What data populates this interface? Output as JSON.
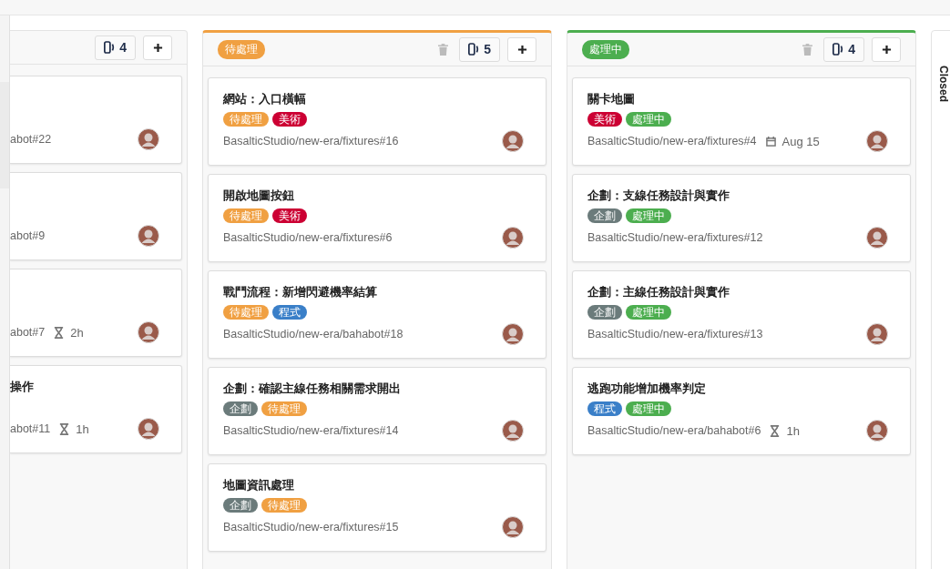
{
  "columns": [
    {
      "deletable": false,
      "count": "4",
      "cut": true,
      "cards": [
        {
          "ref": "abot#22"
        },
        {
          "ref": "abot#9"
        },
        {
          "ref": "abot#7",
          "meta": {
            "kind": "estimate",
            "text": "2h"
          }
        },
        {
          "title": "操作",
          "ref": "abot#11",
          "meta": {
            "kind": "estimate",
            "text": "1h"
          }
        }
      ]
    },
    {
      "label": {
        "text": "待處理",
        "color": "#f0a042"
      },
      "deletable": true,
      "count": "5",
      "cut": false,
      "cards": [
        {
          "title": "網站：入口橫幅",
          "labels": [
            {
              "text": "待處理",
              "color": "#f0a042"
            },
            {
              "text": "美術",
              "color": "#cc0033"
            }
          ],
          "ref": "BasalticStudio/new-era/fixtures#16"
        },
        {
          "title": "開啟地圖按鈕",
          "labels": [
            {
              "text": "待處理",
              "color": "#f0a042"
            },
            {
              "text": "美術",
              "color": "#cc0033"
            }
          ],
          "ref": "BasalticStudio/new-era/fixtures#6"
        },
        {
          "title": "戰鬥流程：新增閃避機率結算",
          "labels": [
            {
              "text": "待處理",
              "color": "#f0a042"
            },
            {
              "text": "程式",
              "color": "#3a7fc8"
            }
          ],
          "ref": "BasalticStudio/new-era/bahabot#18"
        },
        {
          "title": "企劃：確認主線任務相關需求開出",
          "labels": [
            {
              "text": "企劃",
              "color": "#6b7b7b"
            },
            {
              "text": "待處理",
              "color": "#f0a042"
            }
          ],
          "ref": "BasalticStudio/new-era/fixtures#14"
        },
        {
          "title": "地圖資訊處理",
          "labels": [
            {
              "text": "企劃",
              "color": "#6b7b7b"
            },
            {
              "text": "待處理",
              "color": "#f0a042"
            }
          ],
          "ref": "BasalticStudio/new-era/fixtures#15"
        }
      ]
    },
    {
      "label": {
        "text": "處理中",
        "color": "#4cae4f"
      },
      "deletable": true,
      "count": "4",
      "cut": false,
      "cards": [
        {
          "title": "關卡地圖",
          "labels": [
            {
              "text": "美術",
              "color": "#cc0033"
            },
            {
              "text": "處理中",
              "color": "#4cae4f"
            }
          ],
          "ref": "BasalticStudio/new-era/fixtures#4",
          "meta": {
            "kind": "due",
            "text": "Aug 15"
          }
        },
        {
          "title": "企劃：支線任務設計與實作",
          "labels": [
            {
              "text": "企劃",
              "color": "#6b7b7b"
            },
            {
              "text": "處理中",
              "color": "#4cae4f"
            }
          ],
          "ref": "BasalticStudio/new-era/fixtures#12"
        },
        {
          "title": "企劃：主線任務設計與實作",
          "labels": [
            {
              "text": "企劃",
              "color": "#6b7b7b"
            },
            {
              "text": "處理中",
              "color": "#4cae4f"
            }
          ],
          "ref": "BasalticStudio/new-era/fixtures#13"
        },
        {
          "title": "逃跑功能增加機率判定",
          "labels": [
            {
              "text": "程式",
              "color": "#3a7fc8"
            },
            {
              "text": "處理中",
              "color": "#4cae4f"
            }
          ],
          "ref": "BasalticStudio/new-era/bahabot#6",
          "meta": {
            "kind": "estimate",
            "text": "1h"
          }
        }
      ]
    }
  ],
  "closed_column": {
    "title": "Closed"
  }
}
